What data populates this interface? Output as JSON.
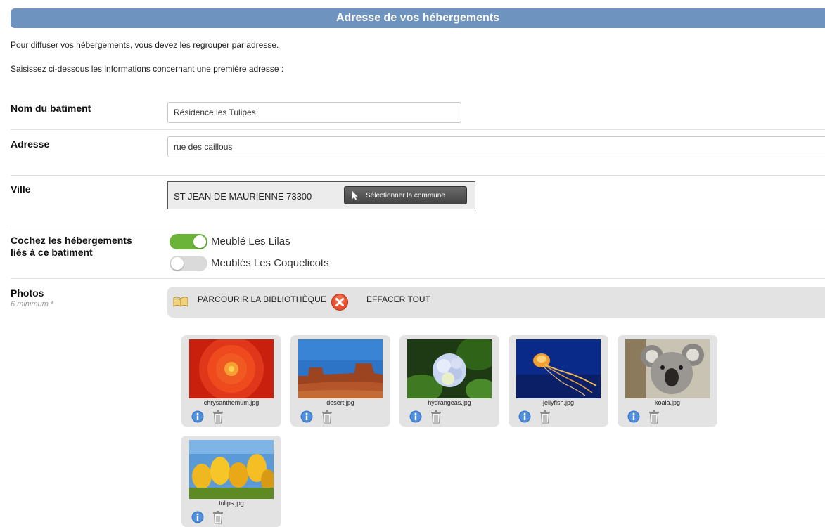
{
  "header": {
    "title": "Adresse de vos hébergements"
  },
  "intro": {
    "line1": "Pour diffuser vos hébergements, vous devez les regrouper par adresse.",
    "line2": "Saisissez ci-dessous les informations concernant une première adresse :"
  },
  "form": {
    "nom_label": "Nom du batiment",
    "nom_value": "Résidence les Tulipes",
    "adresse_label": "Adresse",
    "adresse_value": "rue des caillous",
    "ville_label": "Ville",
    "ville_value": "ST JEAN DE MAURIENNE  73300",
    "ville_button": "Sélectionner la commune",
    "heb_label_line1": "Cochez les hébergements",
    "heb_label_line2": "liés à ce batiment",
    "hebergements": [
      {
        "label": "Meublé Les Lilas",
        "checked": true
      },
      {
        "label": "Meublés Les Coquelicots",
        "checked": false
      }
    ],
    "photos_label": "Photos",
    "photos_sublabel": "6 minimum *",
    "browse_label": "PARCOURIR LA BIBLIOTHÈQUE",
    "clear_label": "EFFACER TOUT"
  },
  "photos": [
    {
      "filename": "chrysanthemum.jpg"
    },
    {
      "filename": "desert.jpg"
    },
    {
      "filename": "hydrangeas.jpg"
    },
    {
      "filename": "jellyfish.jpg"
    },
    {
      "filename": "koala.jpg"
    },
    {
      "filename": "tulips.jpg"
    }
  ],
  "colors": {
    "header_bg": "#6f93bf",
    "toggle_on": "#6ab43a",
    "toggle_off": "#dadada",
    "card_bg": "#e3e3e3"
  }
}
